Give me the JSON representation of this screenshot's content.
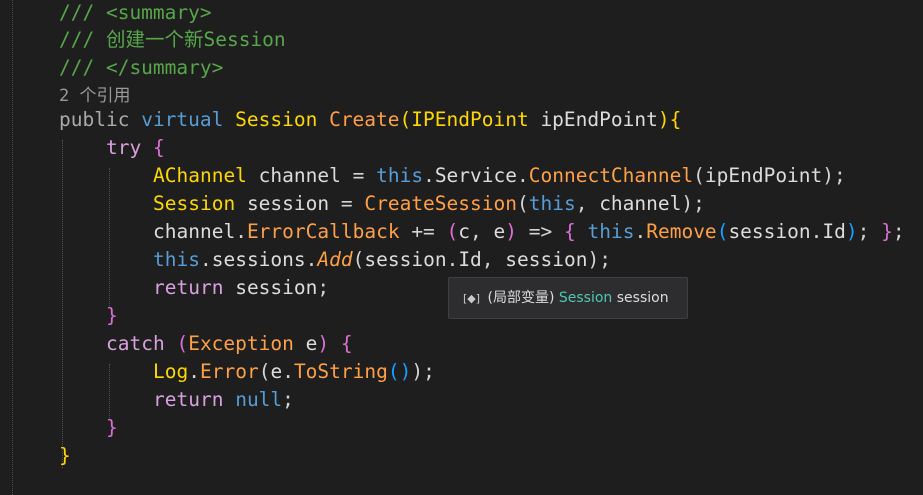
{
  "code": {
    "doc_open": "/// <summary>",
    "doc_text_prefix": "/// ",
    "doc_text": "创建一个新Session",
    "doc_close": "/// </summary>",
    "codelens": "2 个引用",
    "kw_public": "public",
    "kw_virtual": "virtual",
    "type_session": "Session",
    "method_create": "Create",
    "type_ipendpoint": "IPEndPoint",
    "param_ipendpoint": "ipEndPoint",
    "kw_try": "try",
    "type_achannel": "AChannel",
    "var_channel": "channel",
    "kw_this": "this",
    "prop_service": "Service",
    "method_connectchannel": "ConnectChannel",
    "var_session": "session",
    "method_createsession": "CreateSession",
    "prop_errorcallback": "ErrorCallback",
    "op_plus_assign": "+=",
    "lambda_c": "c",
    "lambda_e": "e",
    "op_arrow": "=>",
    "method_remove": "Remove",
    "prop_id": "Id",
    "field_sessions": "sessions",
    "method_add": "Add",
    "kw_return": "return",
    "kw_catch": "catch",
    "type_exception": "Exception",
    "var_e": "e",
    "cls_log": "Log",
    "method_error": "Error",
    "method_tostring": "ToString",
    "kw_null": "null"
  },
  "tooltip": {
    "icon": "[◆]",
    "kind": "(局部变量)",
    "type": "Session",
    "name": "session"
  }
}
